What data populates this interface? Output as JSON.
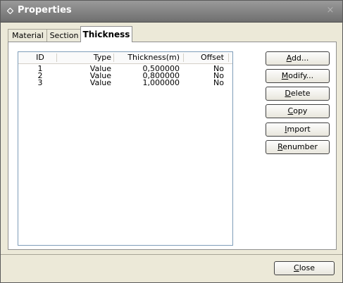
{
  "window": {
    "title": "Properties",
    "close_glyph": "×"
  },
  "tabs": [
    {
      "label": "Material",
      "active": false
    },
    {
      "label": "Section",
      "active": false
    },
    {
      "label": "Thickness",
      "active": true
    }
  ],
  "list": {
    "columns": [
      "ID",
      "Type",
      "Thickness(m)",
      "Offset"
    ],
    "rows": [
      {
        "id": "1",
        "type": "Value",
        "thickness": "0,500000",
        "offset": "No"
      },
      {
        "id": "2",
        "type": "Value",
        "thickness": "0,800000",
        "offset": "No"
      },
      {
        "id": "3",
        "type": "Value",
        "thickness": "1,000000",
        "offset": "No"
      }
    ]
  },
  "buttons": {
    "add": {
      "mn": "A",
      "rest": "dd..."
    },
    "modify": {
      "mn": "M",
      "rest": "odify..."
    },
    "delete": {
      "mn": "D",
      "rest": "elete"
    },
    "copy": {
      "mn": "C",
      "rest": "opy"
    },
    "import": {
      "mn": "I",
      "rest": "mport"
    },
    "renumber": {
      "mn": "R",
      "rest": "enumber"
    },
    "close": {
      "mn": "C",
      "rest": "lose"
    }
  },
  "icons": {
    "title": "diamond-icon",
    "close": "close-icon"
  }
}
